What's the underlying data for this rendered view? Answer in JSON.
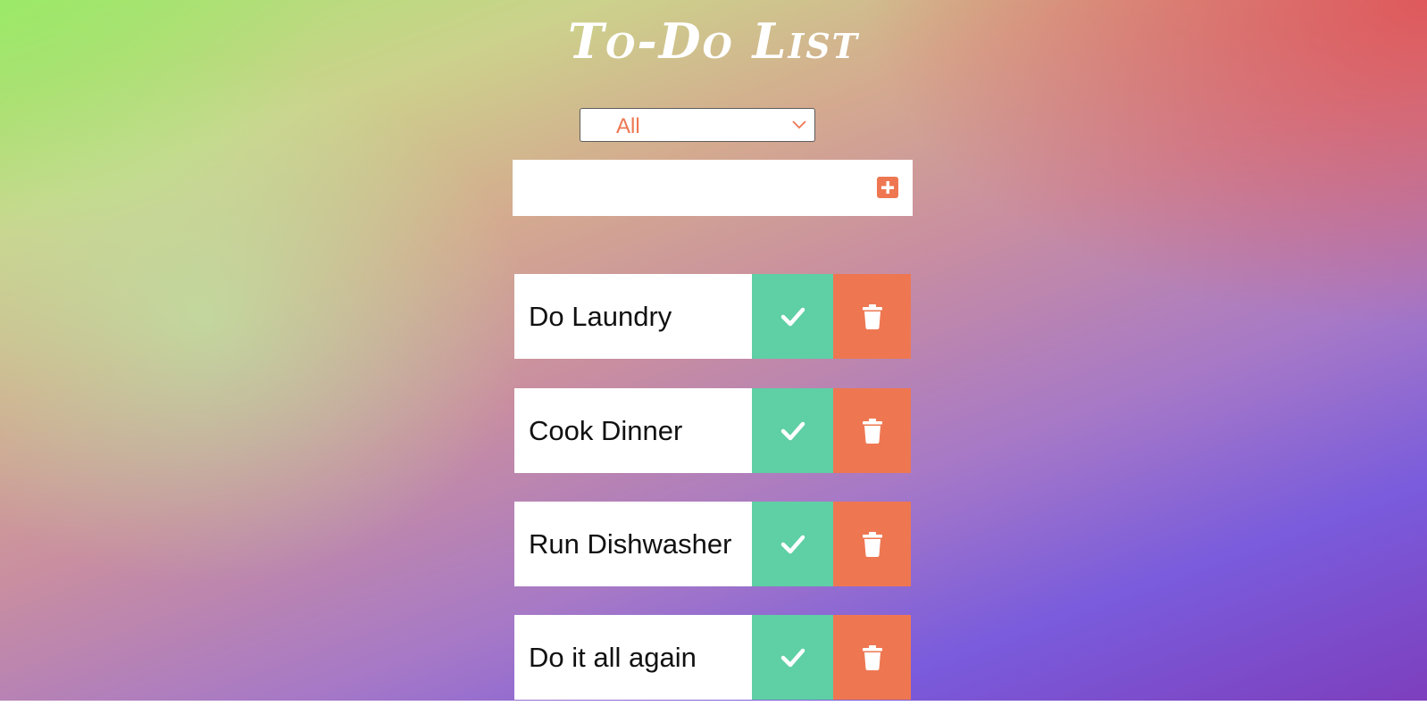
{
  "app": {
    "title": "To-Do List"
  },
  "filter": {
    "selected": "All",
    "icon": "chevron-down-icon"
  },
  "new_todo": {
    "value": "",
    "placeholder": "",
    "add_icon": "plus-square-icon"
  },
  "todos": [
    {
      "text": "Do Laundry",
      "complete_icon": "check-icon",
      "delete_icon": "trash-icon"
    },
    {
      "text": "Cook Dinner",
      "complete_icon": "check-icon",
      "delete_icon": "trash-icon"
    },
    {
      "text": "Run Dishwasher",
      "complete_icon": "check-icon",
      "delete_icon": "trash-icon"
    },
    {
      "text": "Do it all again",
      "complete_icon": "check-icon",
      "delete_icon": "trash-icon"
    }
  ],
  "colors": {
    "accent": "#ee7752",
    "complete": "#5fcfa5",
    "text": "#111111",
    "title": "#ffffff"
  }
}
